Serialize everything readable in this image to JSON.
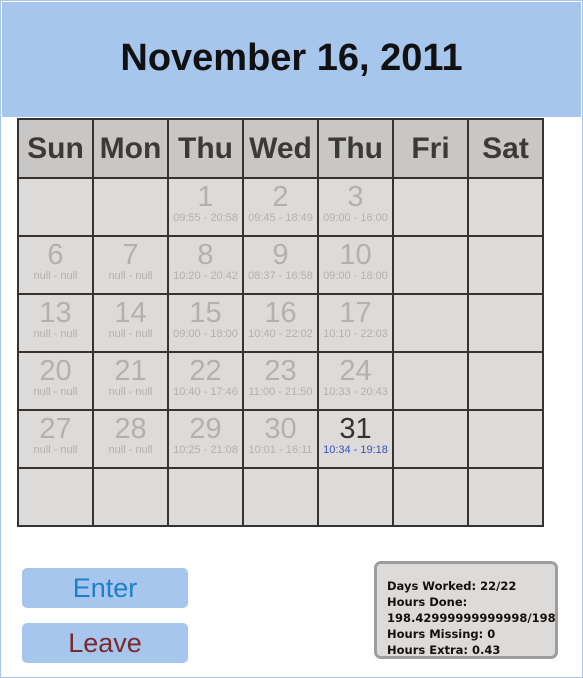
{
  "header": {
    "title": "November 16, 2011"
  },
  "calendar": {
    "weekdays": [
      "Sun",
      "Mon",
      "Thu",
      "Wed",
      "Thu",
      "Fri",
      "Sat"
    ],
    "weeks": [
      [
        {
          "day": "",
          "hours": ""
        },
        {
          "day": "",
          "hours": ""
        },
        {
          "day": "1",
          "hours": "09:55 - 20:58"
        },
        {
          "day": "2",
          "hours": "09:45 - 18:49"
        },
        {
          "day": "3",
          "hours": "09:00 - 16:00"
        },
        {
          "day": "",
          "hours": ""
        },
        {
          "day": "",
          "hours": ""
        }
      ],
      [
        {
          "day": "6",
          "hours": "null - null"
        },
        {
          "day": "7",
          "hours": "null - null"
        },
        {
          "day": "8",
          "hours": "10:20 - 20:42"
        },
        {
          "day": "9",
          "hours": "08:37 - 16:58"
        },
        {
          "day": "10",
          "hours": "09:00 - 18:00"
        },
        {
          "day": "",
          "hours": ""
        },
        {
          "day": "",
          "hours": ""
        }
      ],
      [
        {
          "day": "13",
          "hours": "null - null"
        },
        {
          "day": "14",
          "hours": "null - null"
        },
        {
          "day": "15",
          "hours": "09:00 - 18:00"
        },
        {
          "day": "16",
          "hours": "10:40 - 22:02"
        },
        {
          "day": "17",
          "hours": "10:10 - 22:03"
        },
        {
          "day": "",
          "hours": ""
        },
        {
          "day": "",
          "hours": ""
        }
      ],
      [
        {
          "day": "20",
          "hours": "null - null"
        },
        {
          "day": "21",
          "hours": "null - null"
        },
        {
          "day": "22",
          "hours": "10:40 - 17:46"
        },
        {
          "day": "23",
          "hours": "11:00 - 21:50"
        },
        {
          "day": "24",
          "hours": "10:33 - 20:43"
        },
        {
          "day": "",
          "hours": ""
        },
        {
          "day": "",
          "hours": ""
        }
      ],
      [
        {
          "day": "27",
          "hours": "null - null"
        },
        {
          "day": "28",
          "hours": "null - null"
        },
        {
          "day": "29",
          "hours": "10:25 - 21:08"
        },
        {
          "day": "30",
          "hours": "10:01 - 16:11"
        },
        {
          "day": "31",
          "hours": "10:34 - 19:18",
          "today": true
        },
        {
          "day": "",
          "hours": ""
        },
        {
          "day": "",
          "hours": ""
        }
      ],
      [
        {
          "day": "",
          "hours": ""
        },
        {
          "day": "",
          "hours": ""
        },
        {
          "day": "",
          "hours": ""
        },
        {
          "day": "",
          "hours": ""
        },
        {
          "day": "",
          "hours": ""
        },
        {
          "day": "",
          "hours": ""
        },
        {
          "day": "",
          "hours": ""
        }
      ]
    ]
  },
  "actions": {
    "enter_label": "Enter",
    "leave_label": "Leave"
  },
  "stats": {
    "days_worked": "Days Worked: 22/22",
    "hours_done_label": "Hours Done:",
    "hours_done_value": "198.42999999999998/198",
    "hours_missing": "Hours Missing: 0",
    "hours_extra": "Hours Extra: 0.43"
  },
  "colors": {
    "header_bg": "#a6c6ee",
    "cell_bg": "#dcdbd9",
    "today_hours": "#3b50b8",
    "enter_text": "#1f7fc6",
    "leave_text": "#7a2a2a"
  }
}
